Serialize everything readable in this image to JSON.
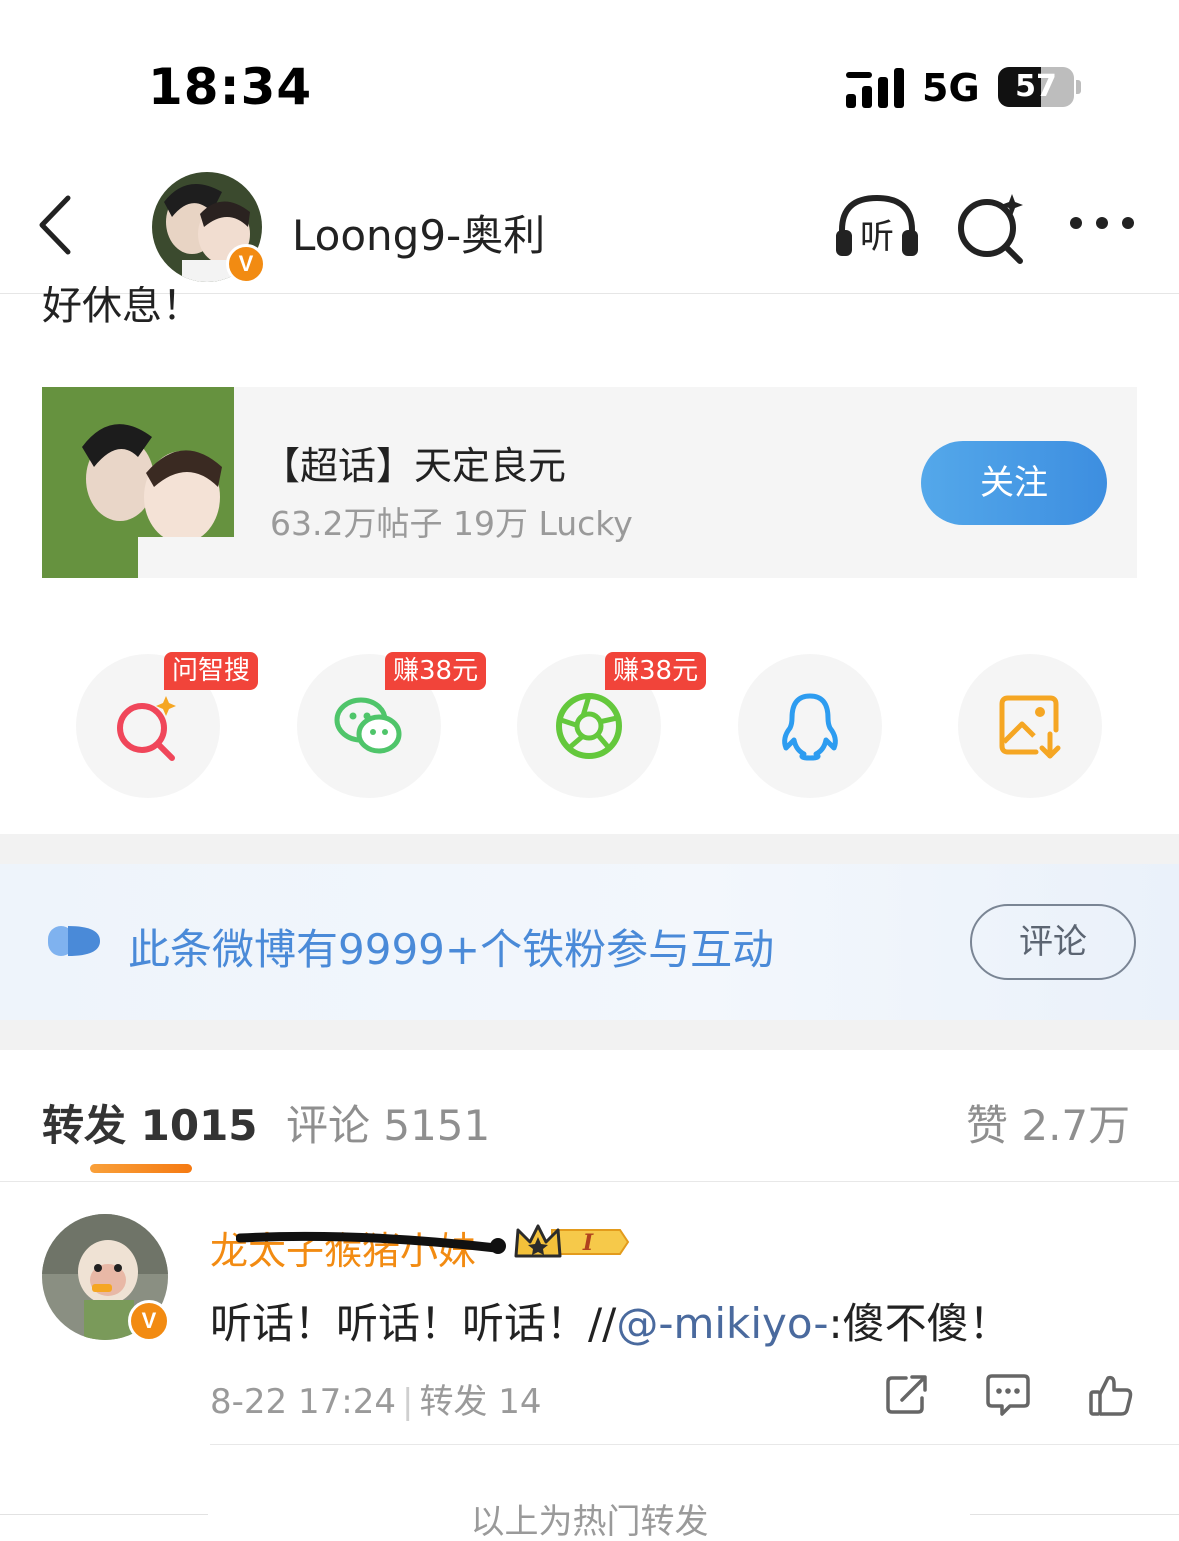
{
  "status_bar": {
    "time": "18:34",
    "network": "5G",
    "battery": "57",
    "battery_level": 0.57
  },
  "nav": {
    "title": "Loong9-奥利",
    "verified_badge": "V",
    "listen_icon_text": "听"
  },
  "post": {
    "text_tail": "好休息！"
  },
  "super_topic": {
    "title": "【超话】天定良元",
    "stats": "63.2万帖子 19万 Lucky",
    "follow_label": "关注"
  },
  "share_row": {
    "items": [
      {
        "icon": "ai-search-icon",
        "tag": "问智搜",
        "color": "#f0465a"
      },
      {
        "icon": "wechat-icon",
        "tag": "赚38元",
        "color": "#4fc56a"
      },
      {
        "icon": "moments-icon",
        "tag": "赚38元",
        "color": "#64c83c"
      },
      {
        "icon": "qq-icon",
        "tag": "",
        "color": "#2d9cf0"
      },
      {
        "icon": "save-image-icon",
        "tag": "",
        "color": "#f5a623"
      }
    ]
  },
  "fan_banner": {
    "text": "此条微博有9999+个铁粉参与互动",
    "button": "评论"
  },
  "tabs": {
    "repost": "转发 1015",
    "comment": "评论 5151",
    "like": "赞 2.7万"
  },
  "repost_item": {
    "username": "龙太子猴猪小妹",
    "rank": "I",
    "text_main": "听话！听话！听话！//",
    "mention": "@-mikiyo-",
    "text_end": ":傻不傻！",
    "time": "8-22 17:24",
    "separator": "|",
    "repost_count": "转发 14",
    "verified_badge": "V"
  },
  "footer": {
    "hot_label": "以上为热门转发"
  },
  "colors": {
    "accent_orange": "#f28b12",
    "follow_blue": "#3d8ee0",
    "fan_blue": "#4a8ad8",
    "tag_red": "#f1443a"
  }
}
